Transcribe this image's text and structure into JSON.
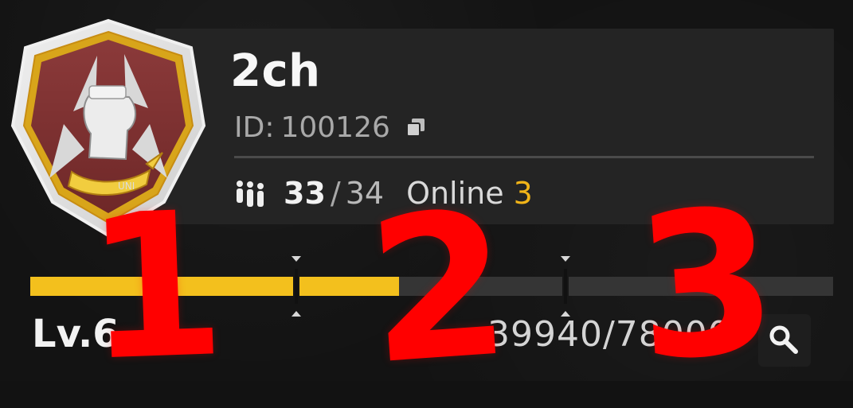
{
  "club": {
    "name": "2ch",
    "id_label": "ID:",
    "id_value": "100126",
    "members_current": "33",
    "members_separator": "/",
    "members_max": "34",
    "online_label": "Online",
    "online_count": "3",
    "emblem_text": "UNI"
  },
  "level": {
    "label": "Lv.6",
    "xp": "39940/78000",
    "segment_progress": [
      1.0,
      0.38,
      0.0
    ]
  },
  "markers": {
    "one": "1",
    "two": "2",
    "three": "3"
  },
  "colors": {
    "accent": "#f3c01d",
    "online": "#f1b418",
    "panel": "#242424",
    "emblem": "#7a2f2f",
    "annotation": "#ff0000"
  },
  "icons": {
    "emblem": "fist-emblem-icon",
    "copy": "copy-icon",
    "members": "members-icon",
    "search": "search-icon"
  }
}
